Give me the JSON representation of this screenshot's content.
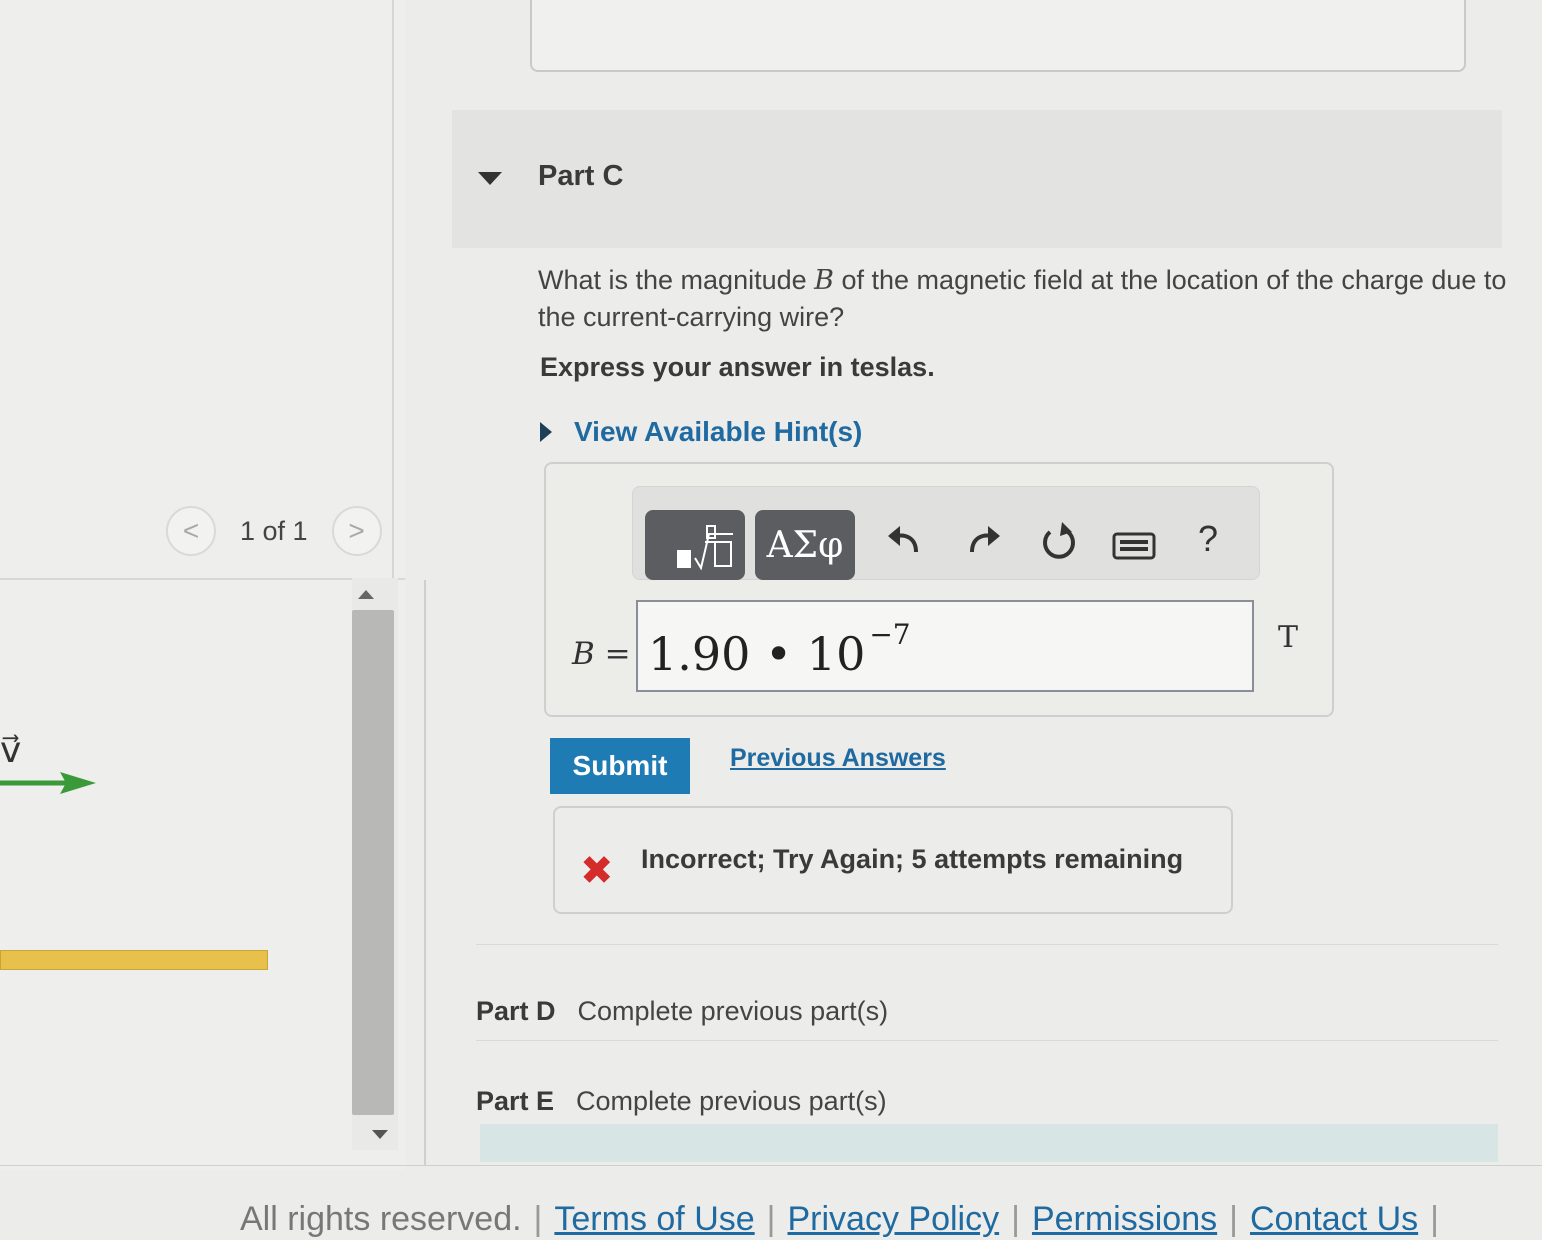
{
  "pager": {
    "prev": "<",
    "text": "1 of 1",
    "next": ">"
  },
  "left": {
    "vector_label": "v⃗"
  },
  "part_c": {
    "title": "Part C",
    "question_pre": "What is the magnitude ",
    "question_var": "B",
    "question_post": " of the magnetic field at the location of the charge due to the current-carrying wire?",
    "instruction": "Express your answer in teslas.",
    "hint_label": "View Available Hint(s)"
  },
  "toolbar": {
    "greek_label": "ΑΣφ",
    "help_label": "?"
  },
  "answer": {
    "label_var": "B",
    "label_eq": " =",
    "mantissa": "1.90 • 10",
    "exponent": "−7",
    "unit": "T"
  },
  "submit_label": "Submit",
  "previous_answers_label": "Previous Answers",
  "feedback": {
    "icon": "✖",
    "text": "Incorrect; Try Again; 5 attempts remaining"
  },
  "later_parts": [
    {
      "label": "Part D",
      "status": "Complete previous part(s)"
    },
    {
      "label": "Part E",
      "status": "Complete previous part(s)"
    }
  ],
  "footer": {
    "rights": "All rights reserved.",
    "links": [
      "Terms of Use",
      "Privacy Policy",
      "Permissions",
      "Contact Us"
    ]
  },
  "colors": {
    "accent": "#1f7bb3",
    "link": "#1f6aa0",
    "error": "#d42b2b",
    "arrow": "#3a9a3a",
    "bar": "#e8c14d"
  }
}
